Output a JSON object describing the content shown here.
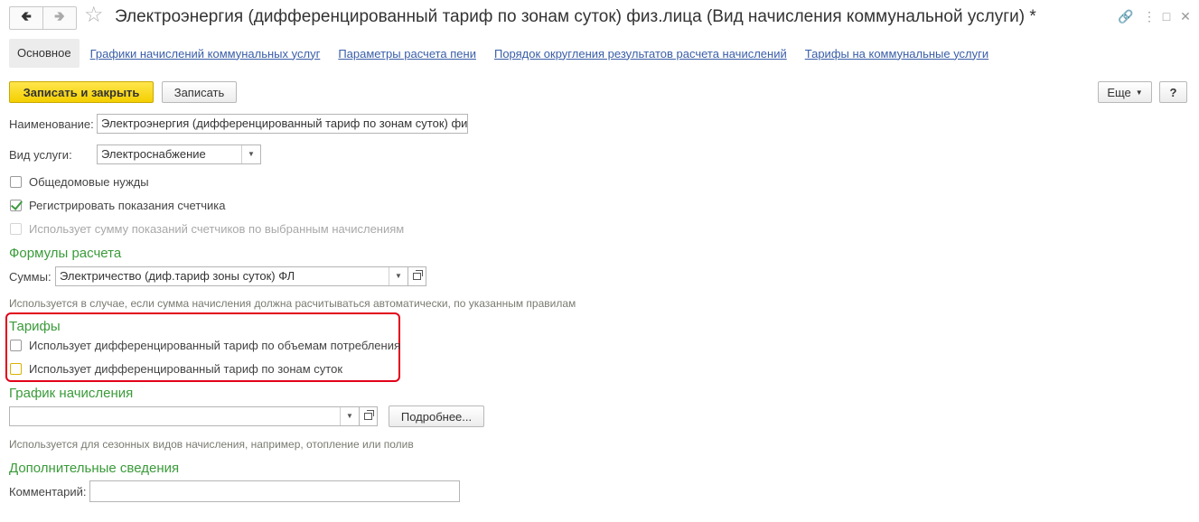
{
  "window": {
    "title": "Электроэнергия (дифференцированный тариф по зонам суток) физ.лица (Вид начисления коммунальной услуги) *"
  },
  "tabs": [
    {
      "label": "Основное",
      "active": true
    },
    {
      "label": "Графики начислений коммунальных услуг"
    },
    {
      "label": "Параметры расчета пени"
    },
    {
      "label": "Порядок округления результатов расчета начислений"
    },
    {
      "label": "Тарифы на коммунальные услуги"
    }
  ],
  "toolbar": {
    "save_close_label": "Записать и закрыть",
    "save_label": "Записать",
    "more_label": "Еще",
    "help_label": "?"
  },
  "form": {
    "name_label": "Наименование:",
    "name_value": "Электроэнергия (дифференцированный тариф по зонам суток) физ.",
    "service_label": "Вид услуги:",
    "service_value": "Электроснабжение",
    "checkbox_common": {
      "label": "Общедомовые нужды",
      "checked": false
    },
    "checkbox_meter": {
      "label": "Регистрировать показания счетчика",
      "checked": true
    },
    "checkbox_sum": {
      "label": "Использует сумму показаний счетчиков по выбранным начислениям",
      "checked": false,
      "disabled": true
    }
  },
  "formulas": {
    "heading": "Формулы расчета",
    "sum_label": "Суммы:",
    "sum_value": "Электричество (диф.тариф зоны суток) ФЛ",
    "hint": "Используется в случае, если сумма начисления должна расчитываться автоматически, по указанным правилам"
  },
  "tariffs": {
    "heading": "Тарифы",
    "by_volume": {
      "label": "Использует дифференцированный тариф по объемам потребления",
      "checked": false
    },
    "by_zones": {
      "label": "Использует дифференцированный тариф по зонам суток",
      "checked": false
    }
  },
  "schedule": {
    "heading": "График начисления",
    "value": "",
    "details_label": "Подробнее...",
    "hint": "Используется для сезонных видов начисления, например, отопление или полив"
  },
  "extra": {
    "heading": "Дополнительные сведения",
    "comment_label": "Комментарий:",
    "comment_value": ""
  },
  "colors": {
    "accent_green": "#3a9b3a",
    "link_blue": "#3a5ea8",
    "primary_yellow": "#f4cf00",
    "highlight_red": "#e2001a"
  }
}
